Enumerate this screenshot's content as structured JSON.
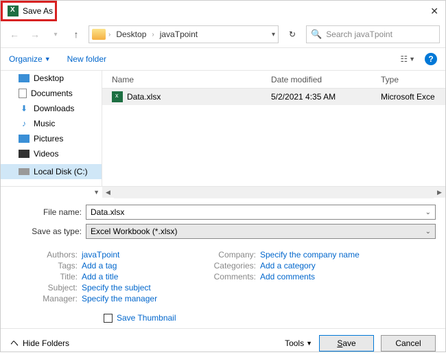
{
  "window": {
    "title": "Save As"
  },
  "breadcrumb": {
    "parts": [
      "Desktop",
      "javaTpoint"
    ],
    "dropdown_icon": "▾"
  },
  "search": {
    "placeholder": "Search javaTpoint"
  },
  "toolbar": {
    "organize": "Organize",
    "newfolder": "New folder"
  },
  "tree": {
    "items": [
      {
        "label": "Desktop",
        "icon": "desktop"
      },
      {
        "label": "Documents",
        "icon": "doc"
      },
      {
        "label": "Downloads",
        "icon": "down"
      },
      {
        "label": "Music",
        "icon": "music"
      },
      {
        "label": "Pictures",
        "icon": "pic"
      },
      {
        "label": "Videos",
        "icon": "vid"
      },
      {
        "label": "Local Disk (C:)",
        "icon": "disk"
      }
    ]
  },
  "list": {
    "headers": {
      "name": "Name",
      "date": "Date modified",
      "type": "Type"
    },
    "rows": [
      {
        "name": "Data.xlsx",
        "date": "5/2/2021 4:35 AM",
        "type": "Microsoft Exce"
      }
    ]
  },
  "form": {
    "filename_label": "File name:",
    "filename_value": "Data.xlsx",
    "savetype_label": "Save as type:",
    "savetype_value": "Excel Workbook (*.xlsx)"
  },
  "meta": {
    "left": [
      {
        "label": "Authors:",
        "value": "javaTpoint"
      },
      {
        "label": "Tags:",
        "value": "Add a tag"
      },
      {
        "label": "Title:",
        "value": "Add a title"
      },
      {
        "label": "Subject:",
        "value": "Specify the subject"
      },
      {
        "label": "Manager:",
        "value": "Specify the manager"
      }
    ],
    "right": [
      {
        "label": "Company:",
        "value": "Specify the company name"
      },
      {
        "label": "Categories:",
        "value": "Add a category"
      },
      {
        "label": "Comments:",
        "value": "Add comments"
      }
    ]
  },
  "thumb": {
    "label": "Save Thumbnail"
  },
  "footer": {
    "hide": "Hide Folders",
    "tools": "Tools",
    "save": "Save",
    "cancel": "Cancel"
  }
}
